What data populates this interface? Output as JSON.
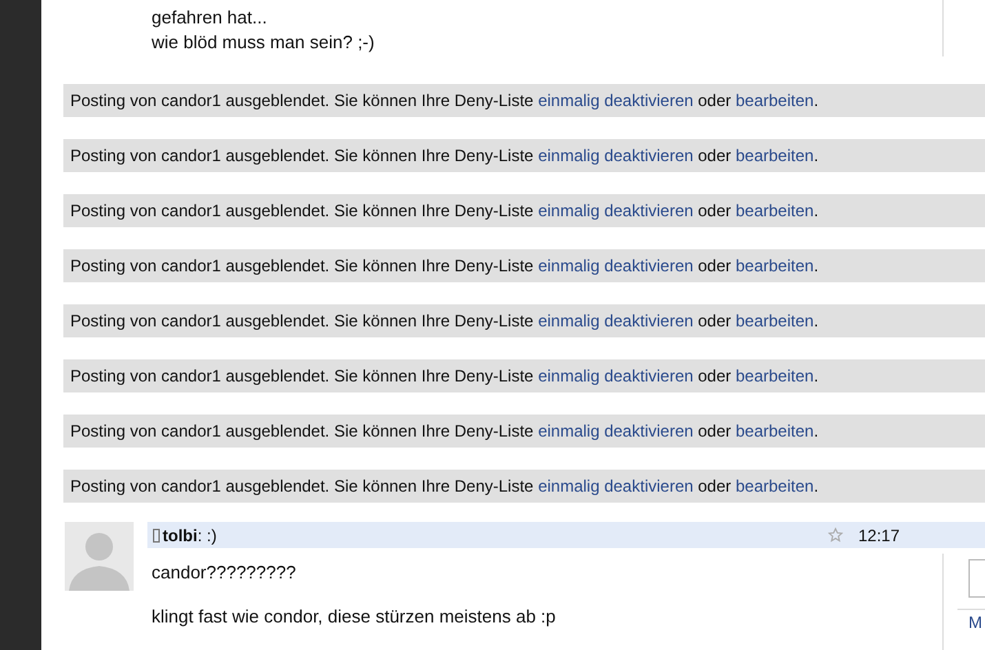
{
  "top_post": {
    "lines": [
      "gefahren hat...",
      "wie blöd muss man sein? ;-)"
    ]
  },
  "hidden_postings": [
    {
      "text": "Posting von candor1 ausgeblendet. Sie können Ihre Deny-Liste ",
      "link_disable": "einmalig deaktivieren",
      "middle": " oder ",
      "link_edit": "bearbeiten",
      "end": "."
    },
    {
      "text": "Posting von candor1 ausgeblendet. Sie können Ihre Deny-Liste ",
      "link_disable": "einmalig deaktivieren",
      "middle": " oder ",
      "link_edit": "bearbeiten",
      "end": "."
    },
    {
      "text": "Posting von candor1 ausgeblendet. Sie können Ihre Deny-Liste ",
      "link_disable": "einmalig deaktivieren",
      "middle": " oder ",
      "link_edit": "bearbeiten",
      "end": "."
    },
    {
      "text": "Posting von candor1 ausgeblendet. Sie können Ihre Deny-Liste ",
      "link_disable": "einmalig deaktivieren",
      "middle": " oder ",
      "link_edit": "bearbeiten",
      "end": "."
    },
    {
      "text": "Posting von candor1 ausgeblendet. Sie können Ihre Deny-Liste ",
      "link_disable": "einmalig deaktivieren",
      "middle": " oder ",
      "link_edit": "bearbeiten",
      "end": "."
    },
    {
      "text": "Posting von candor1 ausgeblendet. Sie können Ihre Deny-Liste ",
      "link_disable": "einmalig deaktivieren",
      "middle": " oder ",
      "link_edit": "bearbeiten",
      "end": "."
    },
    {
      "text": "Posting von candor1 ausgeblendet. Sie können Ihre Deny-Liste ",
      "link_disable": "einmalig deaktivieren",
      "middle": " oder ",
      "link_edit": "bearbeiten",
      "end": "."
    },
    {
      "text": "Posting von candor1 ausgeblendet. Sie können Ihre Deny-Liste ",
      "link_disable": "einmalig deaktivieren",
      "middle": " oder ",
      "link_edit": "bearbeiten",
      "end": "."
    }
  ],
  "post": {
    "author": "tolbi",
    "title": ": :)",
    "starred": false,
    "time": "12:17",
    "lines": [
      "candor?????????",
      "klingt fast wie condor, diese stürzen meistens ab :p"
    ]
  },
  "side_link": "M"
}
